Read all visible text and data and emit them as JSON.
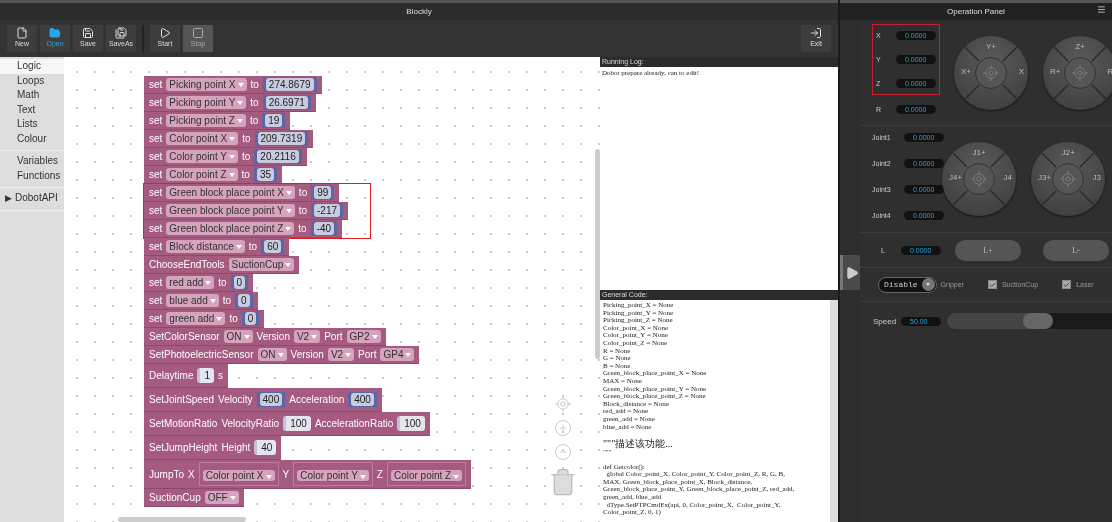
{
  "blockly_window": {
    "title": "Blockly",
    "toolbar": [
      {
        "label": "New",
        "selected": false,
        "disabled": false
      },
      {
        "label": "Open",
        "selected": true,
        "disabled": false
      },
      {
        "label": "Save",
        "selected": false,
        "disabled": false
      },
      {
        "label": "SaveAs",
        "selected": false,
        "disabled": false
      },
      {
        "label": "Start",
        "selected": false,
        "disabled": false
      },
      {
        "label": "Stop",
        "selected": false,
        "disabled": true
      }
    ],
    "exit": {
      "label": "Exit"
    },
    "category_groups": [
      {
        "items": [
          {
            "label": "Logic",
            "selected": true
          },
          {
            "label": "Loops",
            "selected": false
          },
          {
            "label": "Math",
            "selected": false
          },
          {
            "label": "Text",
            "selected": false
          },
          {
            "label": "Lists",
            "selected": false
          },
          {
            "label": "Colour",
            "selected": false
          }
        ]
      },
      {
        "items": [
          {
            "label": "Variables",
            "selected": false
          },
          {
            "label": "Functions",
            "selected": false
          }
        ]
      },
      {
        "items": [
          {
            "label": "DobotAPI",
            "selected": false,
            "marker": "▶"
          }
        ]
      }
    ],
    "block_groups": [
      {
        "highlighted": false,
        "blocks": [
          {
            "kind": "inline",
            "parts": [
              {
                "kind": "label",
                "text": "set"
              },
              {
                "kind": "dropdown",
                "text": "Picking point X"
              },
              {
                "kind": "label",
                "text": "to"
              },
              {
                "kind": "number",
                "text": "274.8679"
              }
            ]
          },
          {
            "kind": "inline",
            "parts": [
              {
                "kind": "label",
                "text": "set"
              },
              {
                "kind": "dropdown",
                "text": "Picking point Y"
              },
              {
                "kind": "label",
                "text": "to"
              },
              {
                "kind": "number",
                "text": "26.6971"
              }
            ]
          },
          {
            "kind": "inline",
            "parts": [
              {
                "kind": "label",
                "text": "set"
              },
              {
                "kind": "dropdown",
                "text": "Picking point Z"
              },
              {
                "kind": "label",
                "text": "to"
              },
              {
                "kind": "number",
                "text": "19"
              }
            ]
          },
          {
            "kind": "inline",
            "parts": [
              {
                "kind": "label",
                "text": "set"
              },
              {
                "kind": "dropdown",
                "text": "Color point X"
              },
              {
                "kind": "label",
                "text": "to"
              },
              {
                "kind": "number",
                "text": "209.7319"
              }
            ]
          },
          {
            "kind": "inline",
            "parts": [
              {
                "kind": "label",
                "text": "set"
              },
              {
                "kind": "dropdown",
                "text": "Color point Y"
              },
              {
                "kind": "label",
                "text": "to"
              },
              {
                "kind": "number",
                "text": "20.2116"
              }
            ]
          },
          {
            "kind": "inline",
            "parts": [
              {
                "kind": "label",
                "text": "set"
              },
              {
                "kind": "dropdown",
                "text": "Color point Z"
              },
              {
                "kind": "label",
                "text": "to"
              },
              {
                "kind": "number",
                "text": "35"
              }
            ]
          }
        ]
      },
      {
        "highlighted": true,
        "blocks": [
          {
            "kind": "inline",
            "parts": [
              {
                "kind": "label",
                "text": "set"
              },
              {
                "kind": "dropdown",
                "text": "Green block place point X"
              },
              {
                "kind": "label",
                "text": "to"
              },
              {
                "kind": "number",
                "text": "99"
              }
            ]
          },
          {
            "kind": "inline",
            "parts": [
              {
                "kind": "label",
                "text": "set"
              },
              {
                "kind": "dropdown",
                "text": "Green block place point Y"
              },
              {
                "kind": "label",
                "text": "to"
              },
              {
                "kind": "number",
                "text": "-217"
              }
            ]
          },
          {
            "kind": "inline",
            "parts": [
              {
                "kind": "label",
                "text": "set"
              },
              {
                "kind": "dropdown",
                "text": "Green block place point Z"
              },
              {
                "kind": "label",
                "text": "to"
              },
              {
                "kind": "number",
                "text": "-40"
              }
            ]
          }
        ]
      },
      {
        "highlighted": false,
        "blocks": [
          {
            "kind": "inline",
            "parts": [
              {
                "kind": "label",
                "text": "set"
              },
              {
                "kind": "dropdown",
                "text": "Block distance"
              },
              {
                "kind": "label",
                "text": "to"
              },
              {
                "kind": "number",
                "text": "60"
              }
            ]
          },
          {
            "kind": "inline",
            "parts": [
              {
                "kind": "label",
                "text": "ChooseEndTools"
              },
              {
                "kind": "dropdown",
                "text": "SuctionCup"
              }
            ]
          },
          {
            "kind": "inline",
            "parts": [
              {
                "kind": "label",
                "text": "set"
              },
              {
                "kind": "dropdown",
                "text": "red add"
              },
              {
                "kind": "label",
                "text": "to"
              },
              {
                "kind": "number",
                "text": "0"
              }
            ]
          },
          {
            "kind": "inline",
            "parts": [
              {
                "kind": "label",
                "text": "set"
              },
              {
                "kind": "dropdown",
                "text": "blue add"
              },
              {
                "kind": "label",
                "text": "to"
              },
              {
                "kind": "number",
                "text": "0"
              }
            ]
          },
          {
            "kind": "inline",
            "parts": [
              {
                "kind": "label",
                "text": "set"
              },
              {
                "kind": "dropdown",
                "text": "green add"
              },
              {
                "kind": "label",
                "text": "to"
              },
              {
                "kind": "number",
                "text": "0"
              }
            ]
          },
          {
            "kind": "inline",
            "parts": [
              {
                "kind": "label",
                "text": "SetColorSensor"
              },
              {
                "kind": "dropdown",
                "text": "ON"
              },
              {
                "kind": "label",
                "text": "Version"
              },
              {
                "kind": "dropdown",
                "text": "V2"
              },
              {
                "kind": "label",
                "text": "Port"
              },
              {
                "kind": "dropdown",
                "text": "GP2"
              }
            ]
          },
          {
            "kind": "inline",
            "parts": [
              {
                "kind": "label",
                "text": "SetPhotoelectricSensor"
              },
              {
                "kind": "dropdown",
                "text": "ON"
              },
              {
                "kind": "label",
                "text": "Version"
              },
              {
                "kind": "dropdown",
                "text": "V2"
              },
              {
                "kind": "label",
                "text": "Port"
              },
              {
                "kind": "dropdown",
                "text": "GP4"
              }
            ]
          },
          {
            "kind": "tall",
            "parts": [
              {
                "kind": "label",
                "text": "Delaytime"
              },
              {
                "kind": "input",
                "text": "1"
              },
              {
                "kind": "label",
                "text": "s"
              }
            ]
          },
          {
            "kind": "tall",
            "parts": [
              {
                "kind": "label",
                "text": "SetJointSpeed"
              },
              {
                "kind": "label",
                "text": "Velocity"
              },
              {
                "kind": "number",
                "text": "400"
              },
              {
                "kind": "label",
                "text": "Acceleration"
              },
              {
                "kind": "number",
                "text": "400"
              }
            ]
          },
          {
            "kind": "tall",
            "parts": [
              {
                "kind": "label",
                "text": "SetMotionRatio"
              },
              {
                "kind": "label",
                "text": "VelocityRatio"
              },
              {
                "kind": "input",
                "text": "100"
              },
              {
                "kind": "label",
                "text": "AccelerationRatio"
              },
              {
                "kind": "input",
                "text": "100"
              }
            ]
          },
          {
            "kind": "tall",
            "parts": [
              {
                "kind": "label",
                "text": "SetJumpHeight"
              },
              {
                "kind": "label",
                "text": "Height"
              },
              {
                "kind": "input",
                "text": "40"
              }
            ]
          },
          {
            "kind": "tall",
            "parts": [
              {
                "kind": "label",
                "text": "JumpTo"
              },
              {
                "kind": "label",
                "text": "X"
              },
              {
                "kind": "variable",
                "text": "Color point X"
              },
              {
                "kind": "label",
                "text": "Y"
              },
              {
                "kind": "variable",
                "text": "Color point Y"
              },
              {
                "kind": "label",
                "text": "Z"
              },
              {
                "kind": "variable",
                "text": "Color point Z"
              }
            ]
          },
          {
            "kind": "inline",
            "parts": [
              {
                "kind": "label",
                "text": "SuctionCup"
              },
              {
                "kind": "dropdown",
                "text": "OFF"
              }
            ]
          }
        ]
      }
    ],
    "running_log": {
      "title": "Running Log:",
      "lines": [
        "Dobot prepare already, can to edit!"
      ]
    },
    "general_code": {
      "title": "General Code:",
      "sections": [
        [
          "Picking_point_X = None",
          "Picking_point_Y = None",
          "Picking_point_Z = None",
          "Color_point_X = None",
          "Color_point_Y = None",
          "Color_point_Z = None",
          "R = None",
          "G = None",
          "B = None",
          "Green_block_place_point_X = None",
          "MAX = None",
          "Green_block_place_point_Y = None",
          "Green_block_place_point_Z = None",
          "Block_distance = None",
          "red_add = None",
          "green_add = None",
          "blue_add = None"
        ],
        [
          "\"\"\"描述该功能...",
          "\"\"\""
        ],
        [
          "def Getcolor():",
          "  global Color_point_X, Color_point_Y, Color_point_Z, R, G, B,",
          "MAX, Green_block_place_point_X, Block_distance,",
          "Green_block_place_point_Y, Green_block_place_point_Z, red_add,",
          "green_add, blue_add",
          "  dType.SetPTPCmdEx(api, 0, Color_point_X,  Color_point_Y,",
          "Color_point_Z, 0, 1)"
        ]
      ]
    }
  },
  "operation_panel": {
    "title": "Operation Panel",
    "coordinate_groups": [
      {
        "highlighted": true,
        "rows": [
          {
            "label": "X",
            "value": "0.0000"
          },
          {
            "label": "Y",
            "value": "0.0000"
          },
          {
            "label": "Z",
            "value": "0.0000"
          }
        ]
      },
      {
        "highlighted": false,
        "rows": [
          {
            "label": "R",
            "value": "0.0000"
          }
        ]
      }
    ],
    "cartesian_pads": [
      {
        "top": "Y+",
        "left": "X+",
        "right": "X"
      },
      {
        "top": "Z+",
        "left": "R+",
        "right": "R"
      }
    ],
    "joints": [
      {
        "label": "Joint1",
        "value": "0.0000"
      },
      {
        "label": "Joint2",
        "value": "0.0000"
      },
      {
        "label": "Joint3",
        "value": "0.0000"
      },
      {
        "label": "Joint4",
        "value": "0.0000"
      }
    ],
    "joint_pads": [
      {
        "top": "J1+",
        "left": "J4+",
        "right": "J4"
      },
      {
        "top": "J2+",
        "left": "J3+",
        "right": "J3"
      }
    ],
    "linear": {
      "label": "L",
      "value": "0.0000",
      "buttons": [
        "L+",
        "L-"
      ]
    },
    "toggle": {
      "label": "Disable",
      "on": false
    },
    "tools": [
      {
        "kind": "plain",
        "label": "Gripper"
      },
      {
        "kind": "checkbox",
        "label": "SuctionCup",
        "checked": true
      },
      {
        "kind": "checkbox",
        "label": "Laser",
        "checked": true
      }
    ],
    "speed": {
      "label": "Speed",
      "value": "50.00",
      "level": 0.55
    }
  }
}
